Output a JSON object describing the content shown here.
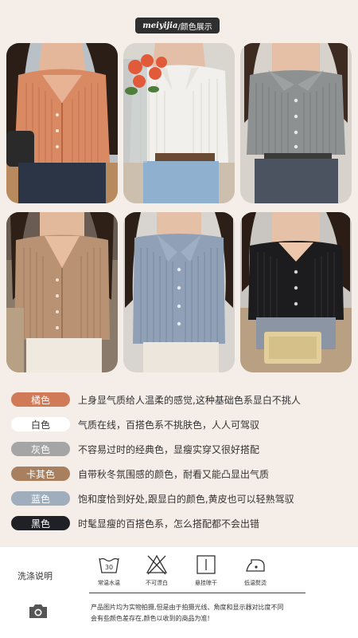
{
  "header": {
    "brand": "meiyijia",
    "subtitle": "/颜色展示"
  },
  "photos": [
    {
      "name": "orange",
      "color": "#d98a63"
    },
    {
      "name": "white",
      "color": "#f2f0ec"
    },
    {
      "name": "gray",
      "color": "#8e9191"
    },
    {
      "name": "khaki",
      "color": "#b99273"
    },
    {
      "name": "blue",
      "color": "#8fa0b7"
    },
    {
      "name": "black",
      "color": "#1c1c1e"
    }
  ],
  "colors": [
    {
      "label": "橘色",
      "desc": "上身显气质给人温柔的感觉,这种基础色系显白不挑人",
      "bg": "#d07a57",
      "fg": "#ffffff"
    },
    {
      "label": "白色",
      "desc": "气质在线，百搭色系不挑肤色，人人可驾驭",
      "bg": "#ffffff",
      "fg": "#333333"
    },
    {
      "label": "灰色",
      "desc": "不容易过时的经典色，显瘦实穿又很好搭配",
      "bg": "#a5a5a5",
      "fg": "#ffffff"
    },
    {
      "label": "卡其色",
      "desc": "自带秋冬氛围感的颜色，耐看又能凸显出气质",
      "bg": "#a9805f",
      "fg": "#ffffff"
    },
    {
      "label": "蓝色",
      "desc": "饱和度恰到好处,跟显白的颜色,黄皮也可以轻熟驾驭",
      "bg": "#a0adbd",
      "fg": "#ffffff"
    },
    {
      "label": "黑色",
      "desc": "时髦显瘦的百搭色系，怎么搭配都不会出错",
      "bg": "#202126",
      "fg": "#ffffff"
    }
  ],
  "care": {
    "label": "洗涤说明",
    "icons": [
      {
        "icon": "wash-30-icon",
        "caption": "常温水温",
        "temp": "30"
      },
      {
        "icon": "no-bleach-icon",
        "caption": "不可漂白"
      },
      {
        "icon": "hang-dry-icon",
        "caption": "悬挂晾干"
      },
      {
        "icon": "low-iron-icon",
        "caption": "低温熨烫"
      }
    ],
    "note_line1": "产品图片均为实物拍摄,但是由于拍摄光线、角度和显示器对比度不同",
    "note_line2": "会有些颜色差存在,颜色以收到的商品为准!"
  }
}
